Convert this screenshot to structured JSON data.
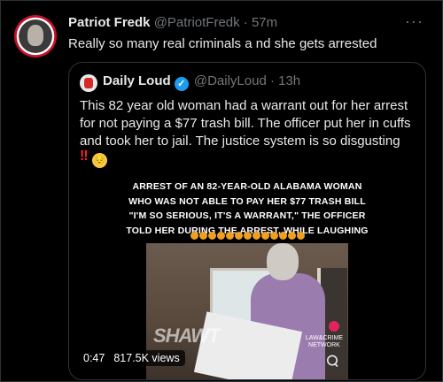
{
  "tweet": {
    "author_name": "Patriot Fredk",
    "handle": "@PatriotFredk",
    "separator": "·",
    "time": "57m",
    "more": "···",
    "text": "Really so many real criminals a nd she gets arrested",
    "avatar_icon": "patriot-seal-avatar-icon"
  },
  "quoted": {
    "author_name": "Daily Loud",
    "handle": "@DailyLoud",
    "separator": "·",
    "time": "13h",
    "verified_glyph": "✓",
    "text": "This 82 year old woman had a warrant out for her arrest for not paying a $77 trash bill. The officer put her in cuffs and took her to jail. The justice system is so disgusting",
    "emoji_bangs": "‼",
    "emoji_face": "😔",
    "media": {
      "caption_lines": [
        "ARREST OF AN 82-YEAR-OLD ALABAMA WOMAN",
        "WHO WAS NOT ABLE TO PAY HER $77 TRASH BILL",
        "\"I'M SO SERIOUS, IT'S A WARRANT,\" THE OFFICER",
        "TOLD HER DURING THE ARREST, WHILE LAUGHING"
      ],
      "video_watermark": "SHAWT",
      "video_logo_line1": "LAW&CRIME",
      "video_logo_line2": "NETWORK",
      "duration": "0:47",
      "views": "817.5K views"
    }
  }
}
